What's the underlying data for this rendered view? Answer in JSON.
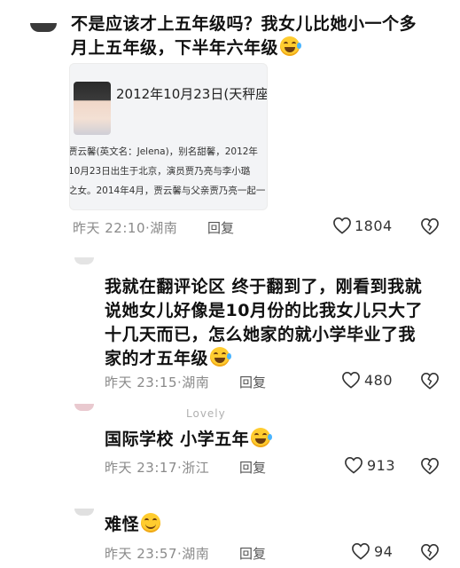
{
  "comment1": {
    "text_line1": "不是应该才上五年级吗？我女儿比她小一个多",
    "text_line2": "月上五年级，下半年六年级",
    "card": {
      "headline": "2012年10月23日(天秤座",
      "lines": [
        "贾云馨(英文名：Jelena)，别名甜馨，2012年",
        "10月23日出生于北京，演员贾乃亮与李小璐",
        "之女。2014年4月，贾云馨与父亲贾乃亮一起一"
      ]
    },
    "time": "昨天 22:10",
    "location": "湖南",
    "reply": "回复",
    "likes": "1804"
  },
  "comment2": {
    "lines": [
      "我就在翻评论区 终于翻到了，刚看到我就",
      "说她女儿好像是10月份的比我女儿只大了",
      "十几天而已，怎么她家的就小学毕业了我",
      "家的才五年级"
    ],
    "time": "昨天 23:15",
    "location": "湖南",
    "reply": "回复",
    "likes": "480"
  },
  "comment3": {
    "faded_name": "Lovely",
    "text": "国际学校 小学五年",
    "time": "昨天 23:17",
    "location": "浙江",
    "reply": "回复",
    "likes": "913"
  },
  "comment4": {
    "text": "难怪",
    "time": "昨天 23:57",
    "location": "湖南",
    "reply": "回复",
    "likes": "94"
  },
  "icons": {
    "like": "heart-outline-icon",
    "dislike": "broken-heart-icon",
    "emoji_laugh": "tears-of-joy-emoji",
    "emoji_smile": "smile-emoji"
  }
}
